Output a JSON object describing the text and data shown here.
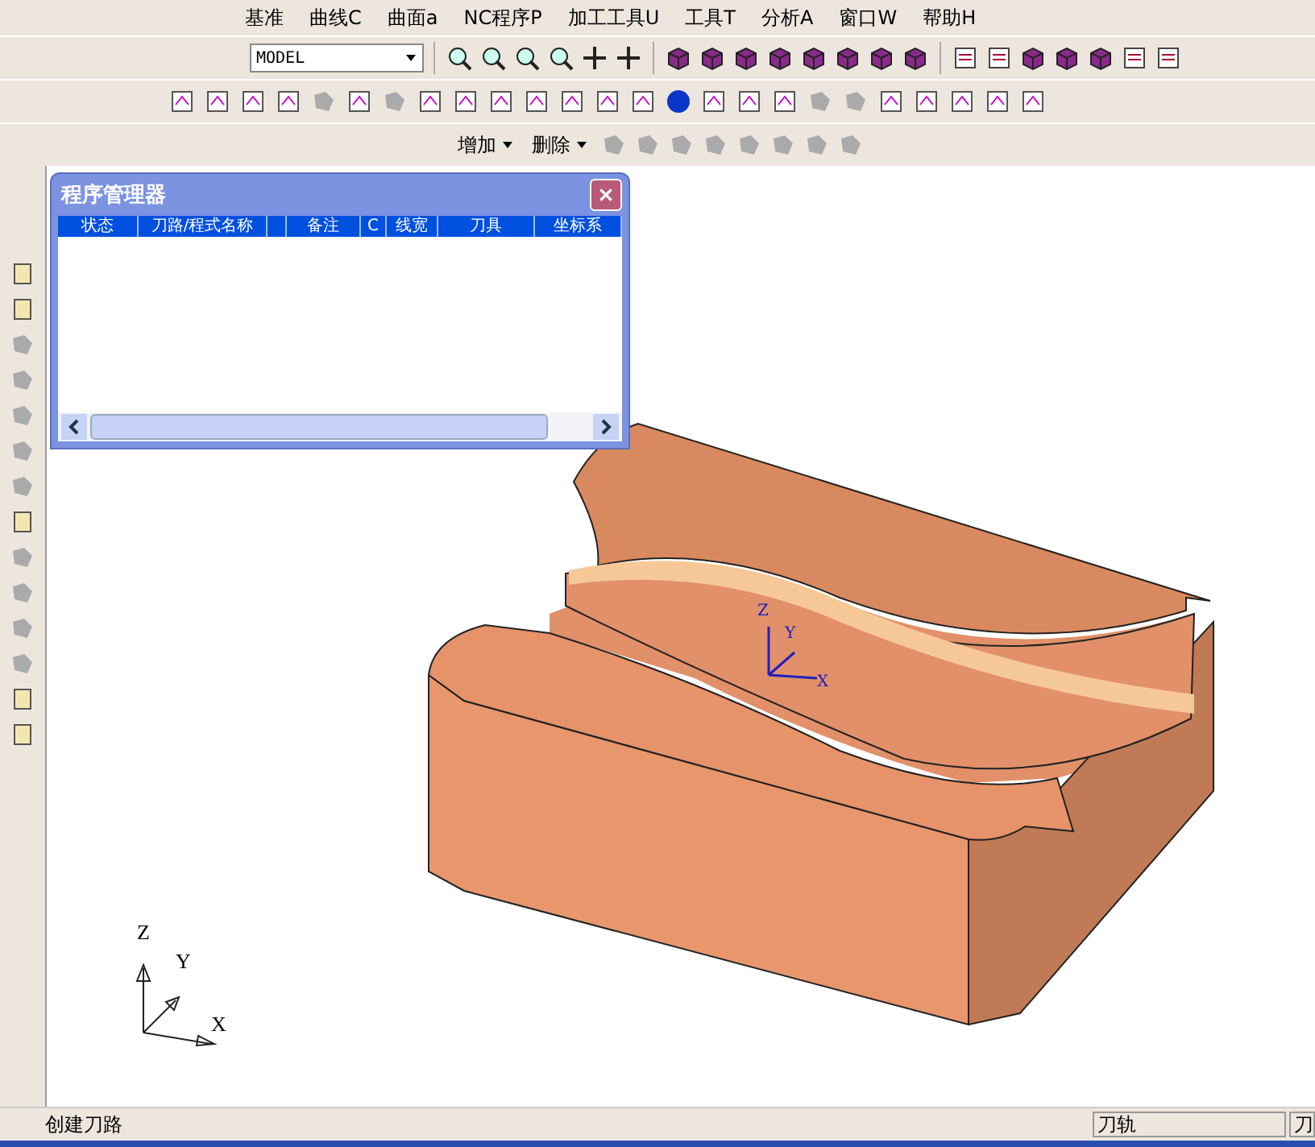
{
  "menu": [
    {
      "label": "基准"
    },
    {
      "label": "曲线C"
    },
    {
      "label": "曲面a"
    },
    {
      "label": "NC程序P"
    },
    {
      "label": "加工工具U"
    },
    {
      "label": "工具T"
    },
    {
      "label": "分析A"
    },
    {
      "label": "窗口W"
    },
    {
      "label": "帮助H"
    }
  ],
  "toolbar": {
    "view_combo": "MODEL",
    "add_menu": "增加",
    "delete_menu": "删除"
  },
  "dialog": {
    "title": "程序管理器",
    "columns": [
      {
        "kind": "text",
        "label": "状态"
      },
      {
        "kind": "text",
        "label": "刀路/程式名称"
      },
      {
        "kind": "blank"
      },
      {
        "kind": "text",
        "label": "备注"
      },
      {
        "kind": "text",
        "label": "C"
      },
      {
        "kind": "text",
        "label": "线宽"
      },
      {
        "kind": "text",
        "label": "刀具"
      },
      {
        "kind": "text",
        "label": "坐标系"
      }
    ]
  },
  "viewport": {
    "wcs_labels": [
      "Z",
      "Y",
      "X"
    ],
    "triad_labels": [
      "Z",
      "Y",
      "X"
    ]
  },
  "status_bar": {
    "message": "创建刀路",
    "panels": [
      "刀轨",
      "刀"
    ]
  }
}
